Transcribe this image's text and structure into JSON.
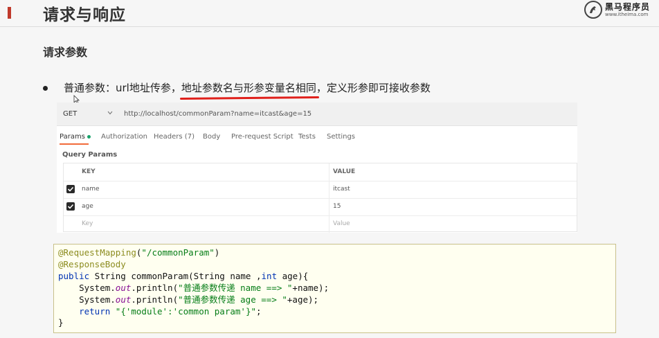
{
  "slide": {
    "title": "请求与响应",
    "section": "请求参数",
    "bullet": {
      "part1": "普通参数：url地址传参，",
      "highlight": "地址参数名与形参变量名相同",
      "part2": "，定义形参即可接收参数"
    },
    "logo": {
      "name": "黑马程序员",
      "url": "www.itheima.com"
    },
    "accent_color": "#c0392b",
    "underline_color": "#e0201b"
  },
  "postman": {
    "method": "GET",
    "url": "http://localhost/commonParam?name=itcast&age=15",
    "tabs": [
      {
        "label": "Params",
        "active": true
      },
      {
        "label": "Authorization"
      },
      {
        "label": "Headers (7)"
      },
      {
        "label": "Body"
      },
      {
        "label": "Pre-request Script"
      },
      {
        "label": "Tests"
      },
      {
        "label": "Settings"
      }
    ],
    "query_params_label": "Query Params",
    "columns": {
      "key": "KEY",
      "value": "VALUE"
    },
    "rows": [
      {
        "key": "name",
        "value": "itcast",
        "checked": true
      },
      {
        "key": "age",
        "value": "15",
        "checked": true
      }
    ],
    "placeholder": {
      "key": "Key",
      "value": "Value"
    }
  },
  "code": {
    "annotation1": "@RequestMapping",
    "annotation1_arg": "\"/commonParam\"",
    "annotation2": "@ResponseBody",
    "sig_kw1": "public",
    "sig_rest1": " String commonParam(String name ,",
    "sig_kw2": "int",
    "sig_rest2": " age){",
    "print1_pre": "System.",
    "print1_out": "out",
    "print1_mid": ".println(",
    "print1_str": "\"普通参数传递 name ==> \"",
    "print1_end": "+name);",
    "print2_pre": "System.",
    "print2_out": "out",
    "print2_mid": ".println(",
    "print2_str": "\"普通参数传递 age ==> \"",
    "print2_end": "+age);",
    "return_kw": "return",
    "return_str": "\"{'module':'common param'}\"",
    "return_end": ";",
    "close": "}"
  }
}
